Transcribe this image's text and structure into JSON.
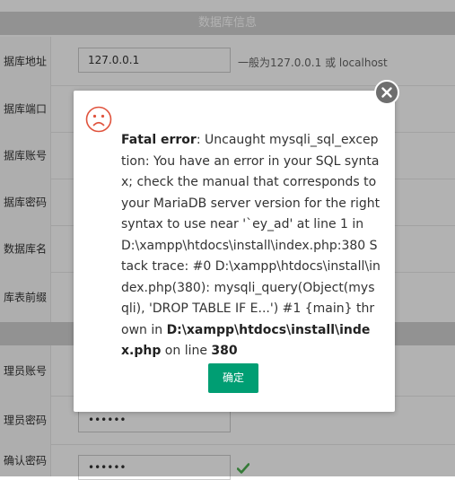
{
  "section_db": "数据库信息",
  "rows": [
    {
      "label": "据库地址",
      "value": "127.0.0.1",
      "hint": "一般为127.0.0.1 或 localhost"
    },
    {
      "label": "据库端口",
      "value": "",
      "hint": ""
    },
    {
      "label": "据库账号",
      "value": "",
      "hint": ""
    },
    {
      "label": "据库密码",
      "value": "",
      "hint": ""
    },
    {
      "label": "数据库名",
      "value": "",
      "hint": ""
    },
    {
      "label": "库表前缀",
      "value": "",
      "hint": ""
    },
    {
      "label": "理员账号",
      "value": "",
      "hint": ""
    },
    {
      "label": "理员密码",
      "value": "••••••",
      "hint": ""
    },
    {
      "label": "确认密码",
      "value": "••••••",
      "hint": ""
    }
  ],
  "dialog": {
    "error_title": "Fatal error",
    "error_sep": ": ",
    "error_body": "Uncaught mysqli_sql_exception: You have an error in your SQL syntax; check the manual that corresponds to your MariaDB server version for the right syntax to use near '`ey_ad' at line 1 in D:\\xampp\\htdocs\\install\\index.php:380 Stack trace: #0 D:\\xampp\\htdocs\\install\\index.php(380): mysqli_query(Object(mysqli), 'DROP TABLE IF E...') #1 {main} thrown in ",
    "error_file": "D:\\xampp\\htdocs\\install\\index.php",
    "error_online": " on line ",
    "error_line": "380",
    "ok_label": "确定"
  },
  "icons": {
    "close": "close-icon",
    "status": "sad-face-icon",
    "valid": "check-icon"
  },
  "colors": {
    "accent": "#009e73",
    "error_icon": "#e0533d",
    "check": "#4caf50",
    "close_bg": "#6e6e6e"
  }
}
